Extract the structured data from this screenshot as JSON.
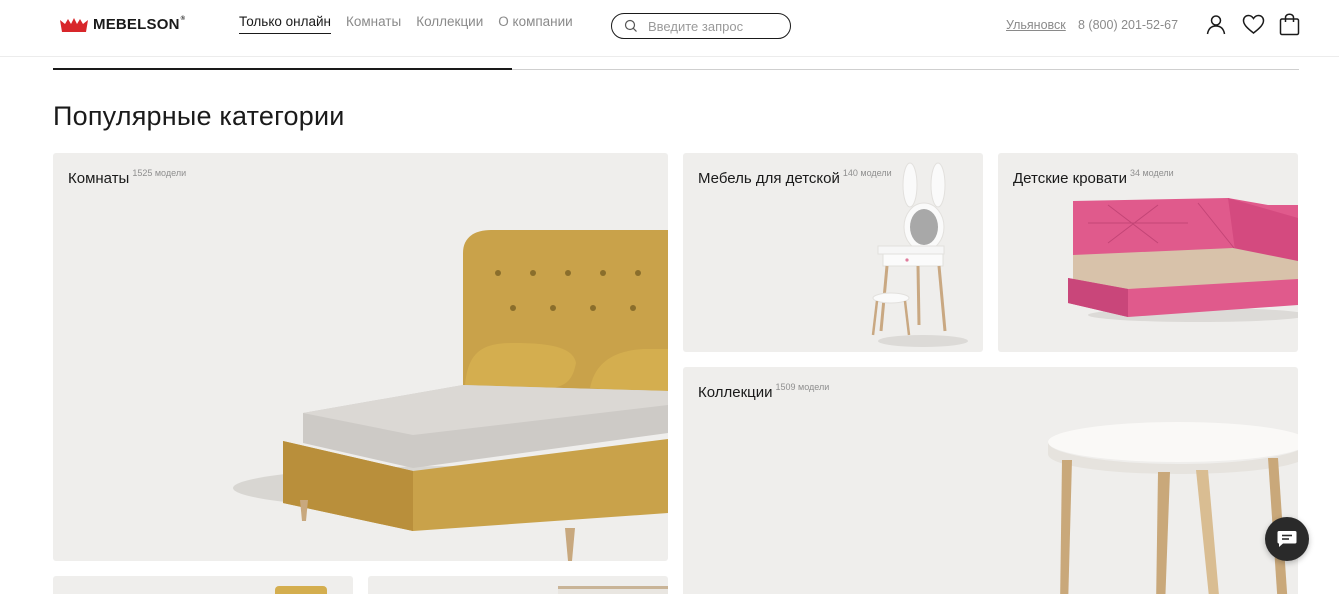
{
  "brand": {
    "name": "MEBELSON",
    "reg": "®",
    "color": "#d8262a"
  },
  "nav": {
    "items": [
      {
        "label": "Только онлайн",
        "active": true
      },
      {
        "label": "Комнаты",
        "active": false
      },
      {
        "label": "Коллекции",
        "active": false
      },
      {
        "label": "О компании",
        "active": false
      }
    ]
  },
  "search": {
    "placeholder": "Введите запрос",
    "icon": "search-icon"
  },
  "header": {
    "city": "Ульяновск",
    "phone": "8 (800) 201-52-67",
    "icons": [
      "user-icon",
      "heart-icon",
      "bag-icon"
    ]
  },
  "section": {
    "title": "Популярные категории"
  },
  "cards": [
    {
      "label": "Комнаты",
      "count": "1525 модели"
    },
    {
      "label": "Мебель для детской",
      "count": "140 модели"
    },
    {
      "label": "Детские кровати",
      "count": "34 модели"
    },
    {
      "label": "Коллекции",
      "count": "1509 модели"
    }
  ],
  "chat": {
    "icon": "chat-icon"
  },
  "colors": {
    "card_bg": "#efeeec",
    "accent_dark": "#1a1a1a",
    "muted": "#8a8a8a"
  }
}
